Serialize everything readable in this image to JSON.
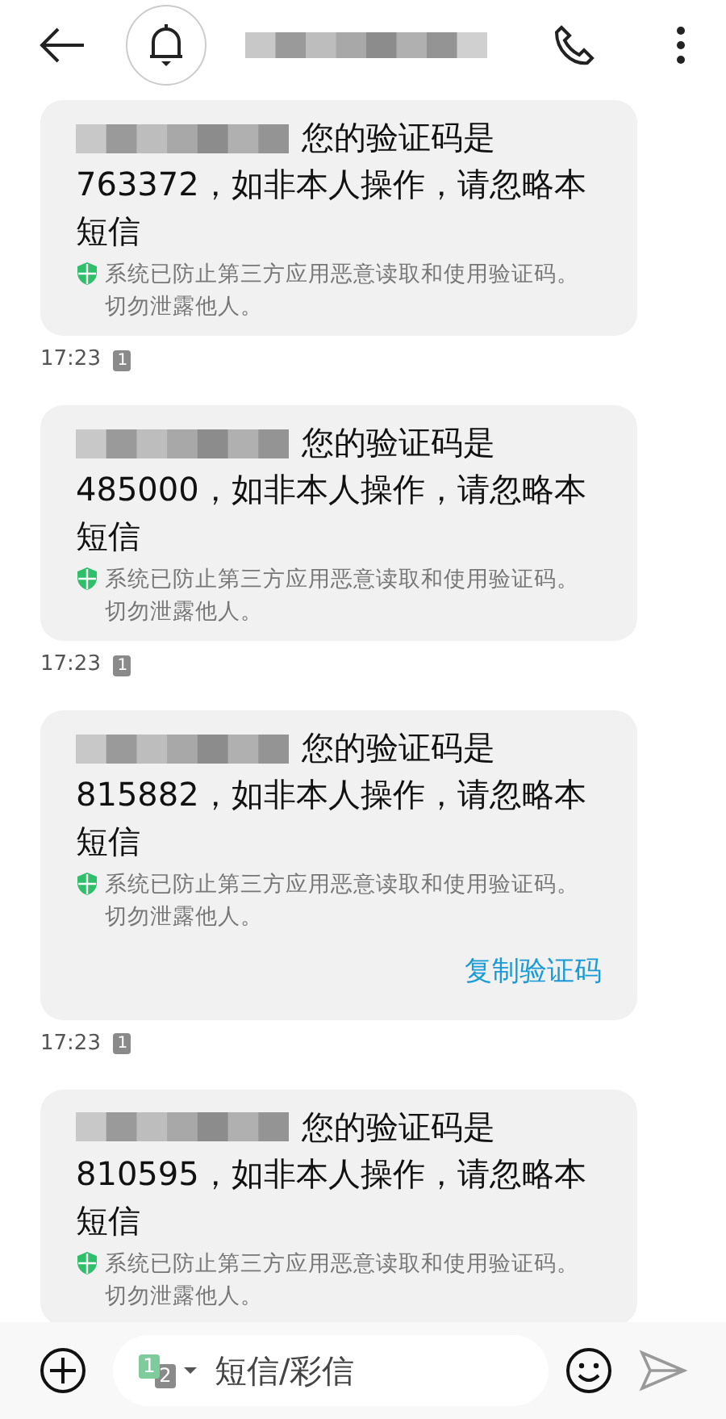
{
  "messages": [
    {
      "intro": "您的验证码是",
      "body": "763372，如非本人操作，请忽略本短信",
      "security_note": "系统已防止第三方应用恶意读取和使用验证码。切勿泄露他人。",
      "time": "17:23",
      "sim": "1"
    },
    {
      "intro": "您的验证码是",
      "body": "485000，如非本人操作，请忽略本短信",
      "security_note": "系统已防止第三方应用恶意读取和使用验证码。切勿泄露他人。",
      "time": "17:23",
      "sim": "1"
    },
    {
      "intro": "您的验证码是",
      "body": "815882，如非本人操作，请忽略本短信",
      "security_note": "系统已防止第三方应用恶意读取和使用验证码。切勿泄露他人。",
      "action": "复制验证码",
      "time": "17:23",
      "sim": "1"
    },
    {
      "intro": "您的验证码是",
      "body": "810595，如非本人操作，请忽略本短信",
      "security_note": "系统已防止第三方应用恶意读取和使用验证码。切勿泄露他人。"
    }
  ],
  "compose": {
    "sims": [
      {
        "label": "1",
        "selected": true
      },
      {
        "label": "2",
        "selected": false
      }
    ],
    "placeholder": "短信/彩信"
  }
}
